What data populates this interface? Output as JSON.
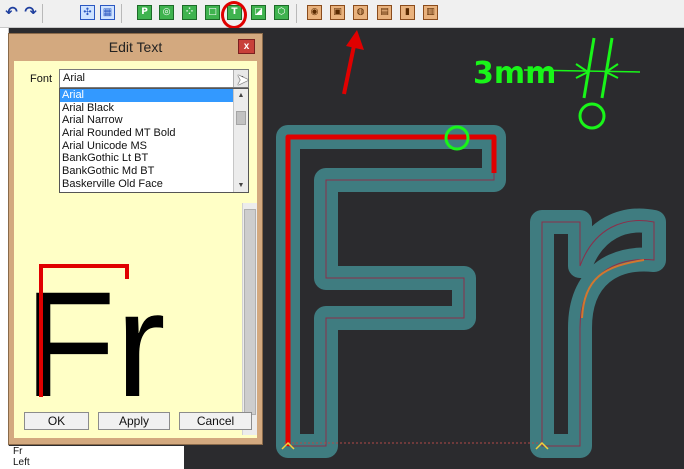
{
  "dialog": {
    "title": "Edit Text",
    "close_glyph": "x",
    "font_label": "Font",
    "font_value": "Arial",
    "font_options": [
      "Arial",
      "Arial Black",
      "Arial Narrow",
      "Arial Rounded MT Bold",
      "Arial Unicode MS",
      "BankGothic Lt BT",
      "BankGothic Md BT",
      "Baskerville Old Face"
    ],
    "preview_text": "Fr",
    "ok_label": "OK",
    "apply_label": "Apply",
    "cancel_label": "Cancel"
  },
  "canvas": {
    "annotation_text": "3mm",
    "text": "Fr"
  },
  "toolbar": {
    "icons": [
      "undo-icon",
      "redo-icon",
      "snap-icon",
      "grid-icon",
      "p-tool-icon",
      "circle-tool-icon",
      "dots-tool-icon",
      "square-tool-icon",
      "text-tool-icon",
      "shape-tool-icon",
      "box-tool-icon",
      "target-icon",
      "layers-icon",
      "camera-icon",
      "material-icon",
      "bottle-icon",
      "gallery-icon"
    ]
  },
  "bottom_list": [
    "Fr",
    "Left"
  ],
  "colors": {
    "canvas_bg": "#2b2b2e",
    "outline_teal": "#3f7c80",
    "highlight_red": "#e00000",
    "annotation_green": "#19f519",
    "dialog_client": "#ffffc6"
  }
}
